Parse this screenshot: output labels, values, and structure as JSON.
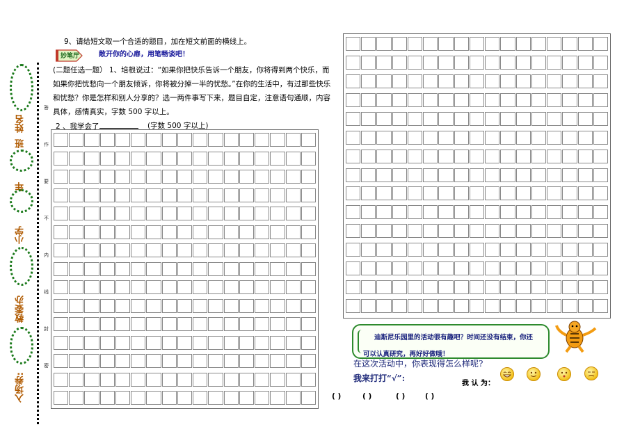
{
  "left_margin": {
    "labels": [
      "姓名",
      "班",
      "年",
      "小学",
      "教委办",
      "入场券:"
    ],
    "seal_chars": [
      "答",
      "作",
      "要",
      "不",
      "内",
      "线",
      "封",
      "密"
    ]
  },
  "question9": "9、请给短文取一个合适的题目，加在短文前面的横线上。",
  "badge": "妙笔厅",
  "banner": "敞开你的心扉，用笔畅谈吧！",
  "prompt": {
    "line1": "(二题任选一题） 1、培根说过：“如果你把快乐告诉一个朋友，你将得到两个快乐，而",
    "line2": "如果你把忧愁向一个朋友倾诉，你将被分掉一半的忧愁。”在你的生活中，有过那些快乐",
    "line3": "和忧愁？你是怎样和别人分享的？选一两件事写下来，题目自定，注意语句通顺，内容",
    "line4": "具体，感情真实，字数 500 字以上。"
  },
  "option2": "2 、我学会了",
  "word_count": "(字数 500 字以上)",
  "callout": {
    "line1": "迪斯尼乐园里的活动很有趣吧？时间还没有结束，你还",
    "line2": "可以认真研究，再好好做哦！"
  },
  "self_eval": {
    "question": "在这次活动中，你表现得怎么样呢?",
    "instruction": "我来打打“√”:",
    "i_think": "我 认 为：",
    "brackets": [
      "(     )",
      "(     )",
      "(     )",
      "(     )"
    ]
  }
}
